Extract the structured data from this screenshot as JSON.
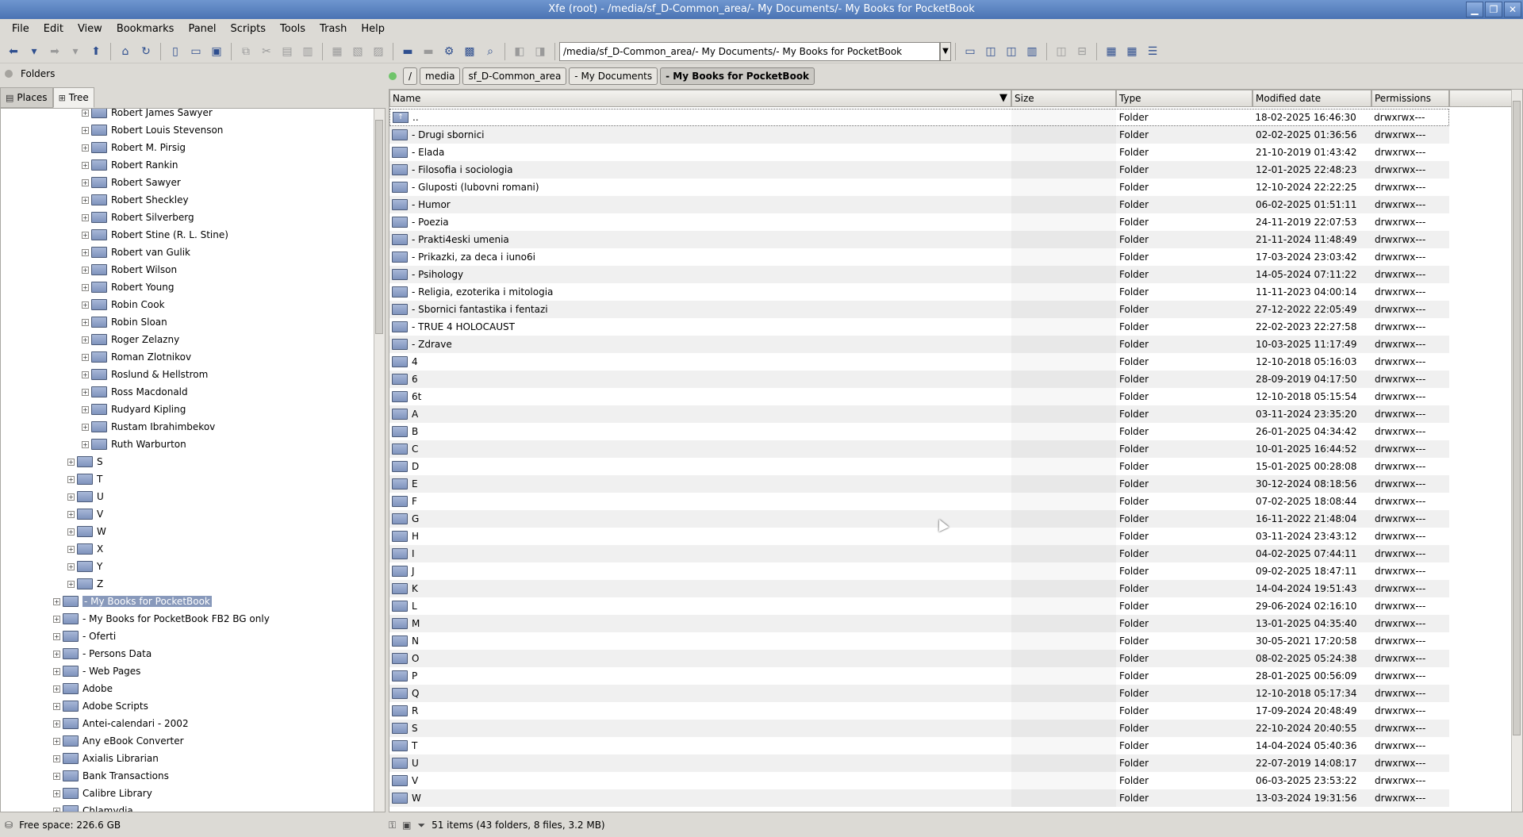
{
  "window": {
    "title": "Xfe (root) - /media/sf_D-Common_area/- My Documents/- My Books for PocketBook",
    "buttons": [
      "▁",
      "❐",
      "✕"
    ]
  },
  "menu": [
    "File",
    "Edit",
    "View",
    "Bookmarks",
    "Panel",
    "Scripts",
    "Tools",
    "Trash",
    "Help"
  ],
  "toolbar": {
    "path_value": "/media/sf_D-Common_area/- My Documents/- My Books for PocketBook"
  },
  "left": {
    "header": "Folders",
    "tabs": [
      {
        "label": "Places",
        "active": false
      },
      {
        "label": "Tree",
        "active": true
      }
    ],
    "tree": [
      {
        "label": "Robert James Sawyer",
        "level": 3
      },
      {
        "label": "Robert Louis Stevenson",
        "level": 3
      },
      {
        "label": "Robert M. Pirsig",
        "level": 3
      },
      {
        "label": "Robert Rankin",
        "level": 3
      },
      {
        "label": "Robert Sawyer",
        "level": 3
      },
      {
        "label": "Robert Sheckley",
        "level": 3
      },
      {
        "label": "Robert Silverberg",
        "level": 3
      },
      {
        "label": "Robert Stine (R. L. Stine)",
        "level": 3
      },
      {
        "label": "Robert van Gulik",
        "level": 3
      },
      {
        "label": "Robert Wilson",
        "level": 3
      },
      {
        "label": "Robert Young",
        "level": 3
      },
      {
        "label": "Robin Cook",
        "level": 3
      },
      {
        "label": "Robin Sloan",
        "level": 3
      },
      {
        "label": "Roger Zelazny",
        "level": 3
      },
      {
        "label": "Roman Zlotnikov",
        "level": 3
      },
      {
        "label": "Roslund & Hellstrom",
        "level": 3
      },
      {
        "label": "Ross Macdonald",
        "level": 3
      },
      {
        "label": "Rudyard Kipling",
        "level": 3
      },
      {
        "label": "Rustam Ibrahimbekov",
        "level": 3
      },
      {
        "label": "Ruth Warburton",
        "level": 3
      },
      {
        "label": "S",
        "level": 2
      },
      {
        "label": "T",
        "level": 2
      },
      {
        "label": "U",
        "level": 2
      },
      {
        "label": "V",
        "level": 2
      },
      {
        "label": "W",
        "level": 2
      },
      {
        "label": "X",
        "level": 2
      },
      {
        "label": "Y",
        "level": 2
      },
      {
        "label": "Z",
        "level": 2
      },
      {
        "label": "- My Books for PocketBook",
        "level": 1,
        "selected": true
      },
      {
        "label": "- My Books for PocketBook FB2 BG only",
        "level": 1
      },
      {
        "label": "- Oferti",
        "level": 1
      },
      {
        "label": "- Persons Data",
        "level": 1
      },
      {
        "label": "- Web Pages",
        "level": 1
      },
      {
        "label": "Adobe",
        "level": 1
      },
      {
        "label": "Adobe Scripts",
        "level": 1
      },
      {
        "label": "Antei-calendari - 2002",
        "level": 1
      },
      {
        "label": "Any eBook Converter",
        "level": 1
      },
      {
        "label": "Axialis Librarian",
        "level": 1
      },
      {
        "label": "Bank Transactions",
        "level": 1
      },
      {
        "label": "Calibre Library",
        "level": 1
      },
      {
        "label": "Chlamydia",
        "level": 1
      }
    ]
  },
  "breadcrumbs": [
    "/",
    "media",
    "sf_D-Common_area",
    "- My Documents",
    "- My Books for PocketBook"
  ],
  "columns": [
    "Name",
    "Size",
    "Type",
    "Modified date",
    "Permissions"
  ],
  "files": [
    {
      "name": "..",
      "type": "Folder",
      "date": "18-02-2025 16:46:30",
      "perm": "drwxrwx---"
    },
    {
      "name": "- Drugi sbornici",
      "type": "Folder",
      "date": "02-02-2025 01:36:56",
      "perm": "drwxrwx---"
    },
    {
      "name": "- Elada",
      "type": "Folder",
      "date": "21-10-2019 01:43:42",
      "perm": "drwxrwx---"
    },
    {
      "name": "- Filosofia i sociologia",
      "type": "Folder",
      "date": "12-01-2025 22:48:23",
      "perm": "drwxrwx---"
    },
    {
      "name": "- Gluposti (lubovni romani)",
      "type": "Folder",
      "date": "12-10-2024 22:22:25",
      "perm": "drwxrwx---"
    },
    {
      "name": "- Humor",
      "type": "Folder",
      "date": "06-02-2025 01:51:11",
      "perm": "drwxrwx---"
    },
    {
      "name": "- Poezia",
      "type": "Folder",
      "date": "24-11-2019 22:07:53",
      "perm": "drwxrwx---"
    },
    {
      "name": "- Prakti4eski umenia",
      "type": "Folder",
      "date": "21-11-2024 11:48:49",
      "perm": "drwxrwx---"
    },
    {
      "name": "- Prikazki, za deca i iuno6i",
      "type": "Folder",
      "date": "17-03-2024 23:03:42",
      "perm": "drwxrwx---"
    },
    {
      "name": "- Psihology",
      "type": "Folder",
      "date": "14-05-2024 07:11:22",
      "perm": "drwxrwx---"
    },
    {
      "name": "- Religia, ezoterika i mitologia",
      "type": "Folder",
      "date": "11-11-2023 04:00:14",
      "perm": "drwxrwx---"
    },
    {
      "name": "- Sbornici fantastika i fentazi",
      "type": "Folder",
      "date": "27-12-2022 22:05:49",
      "perm": "drwxrwx---"
    },
    {
      "name": "- TRUE 4 HOLOCAUST",
      "type": "Folder",
      "date": "22-02-2023 22:27:58",
      "perm": "drwxrwx---"
    },
    {
      "name": "- Zdrave",
      "type": "Folder",
      "date": "10-03-2025 11:17:49",
      "perm": "drwxrwx---"
    },
    {
      "name": "4",
      "type": "Folder",
      "date": "12-10-2018 05:16:03",
      "perm": "drwxrwx---"
    },
    {
      "name": "6",
      "type": "Folder",
      "date": "28-09-2019 04:17:50",
      "perm": "drwxrwx---"
    },
    {
      "name": "6t",
      "type": "Folder",
      "date": "12-10-2018 05:15:54",
      "perm": "drwxrwx---"
    },
    {
      "name": "A",
      "type": "Folder",
      "date": "03-11-2024 23:35:20",
      "perm": "drwxrwx---"
    },
    {
      "name": "B",
      "type": "Folder",
      "date": "26-01-2025 04:34:42",
      "perm": "drwxrwx---"
    },
    {
      "name": "C",
      "type": "Folder",
      "date": "10-01-2025 16:44:52",
      "perm": "drwxrwx---"
    },
    {
      "name": "D",
      "type": "Folder",
      "date": "15-01-2025 00:28:08",
      "perm": "drwxrwx---"
    },
    {
      "name": "E",
      "type": "Folder",
      "date": "30-12-2024 08:18:56",
      "perm": "drwxrwx---"
    },
    {
      "name": "F",
      "type": "Folder",
      "date": "07-02-2025 18:08:44",
      "perm": "drwxrwx---"
    },
    {
      "name": "G",
      "type": "Folder",
      "date": "16-11-2022 21:48:04",
      "perm": "drwxrwx---"
    },
    {
      "name": "H",
      "type": "Folder",
      "date": "03-11-2024 23:43:12",
      "perm": "drwxrwx---"
    },
    {
      "name": "I",
      "type": "Folder",
      "date": "04-02-2025 07:44:11",
      "perm": "drwxrwx---"
    },
    {
      "name": "J",
      "type": "Folder",
      "date": "09-02-2025 18:47:11",
      "perm": "drwxrwx---"
    },
    {
      "name": "K",
      "type": "Folder",
      "date": "14-04-2024 19:51:43",
      "perm": "drwxrwx---"
    },
    {
      "name": "L",
      "type": "Folder",
      "date": "29-06-2024 02:16:10",
      "perm": "drwxrwx---"
    },
    {
      "name": "M",
      "type": "Folder",
      "date": "13-01-2025 04:35:40",
      "perm": "drwxrwx---"
    },
    {
      "name": "N",
      "type": "Folder",
      "date": "30-05-2021 17:20:58",
      "perm": "drwxrwx---"
    },
    {
      "name": "O",
      "type": "Folder",
      "date": "08-02-2025 05:24:38",
      "perm": "drwxrwx---"
    },
    {
      "name": "P",
      "type": "Folder",
      "date": "28-01-2025 00:56:09",
      "perm": "drwxrwx---"
    },
    {
      "name": "Q",
      "type": "Folder",
      "date": "12-10-2018 05:17:34",
      "perm": "drwxrwx---"
    },
    {
      "name": "R",
      "type": "Folder",
      "date": "17-09-2024 20:48:49",
      "perm": "drwxrwx---"
    },
    {
      "name": "S",
      "type": "Folder",
      "date": "22-10-2024 20:40:55",
      "perm": "drwxrwx---"
    },
    {
      "name": "T",
      "type": "Folder",
      "date": "14-04-2024 05:40:36",
      "perm": "drwxrwx---"
    },
    {
      "name": "U",
      "type": "Folder",
      "date": "22-07-2019 14:08:17",
      "perm": "drwxrwx---"
    },
    {
      "name": "V",
      "type": "Folder",
      "date": "06-03-2025 23:53:22",
      "perm": "drwxrwx---"
    },
    {
      "name": "W",
      "type": "Folder",
      "date": "13-03-2024 19:31:56",
      "perm": "drwxrwx---"
    }
  ],
  "status": {
    "free_space": "Free space: 226.6 GB",
    "items": "51 items (43 folders, 8 files, 3.2 MB)"
  }
}
